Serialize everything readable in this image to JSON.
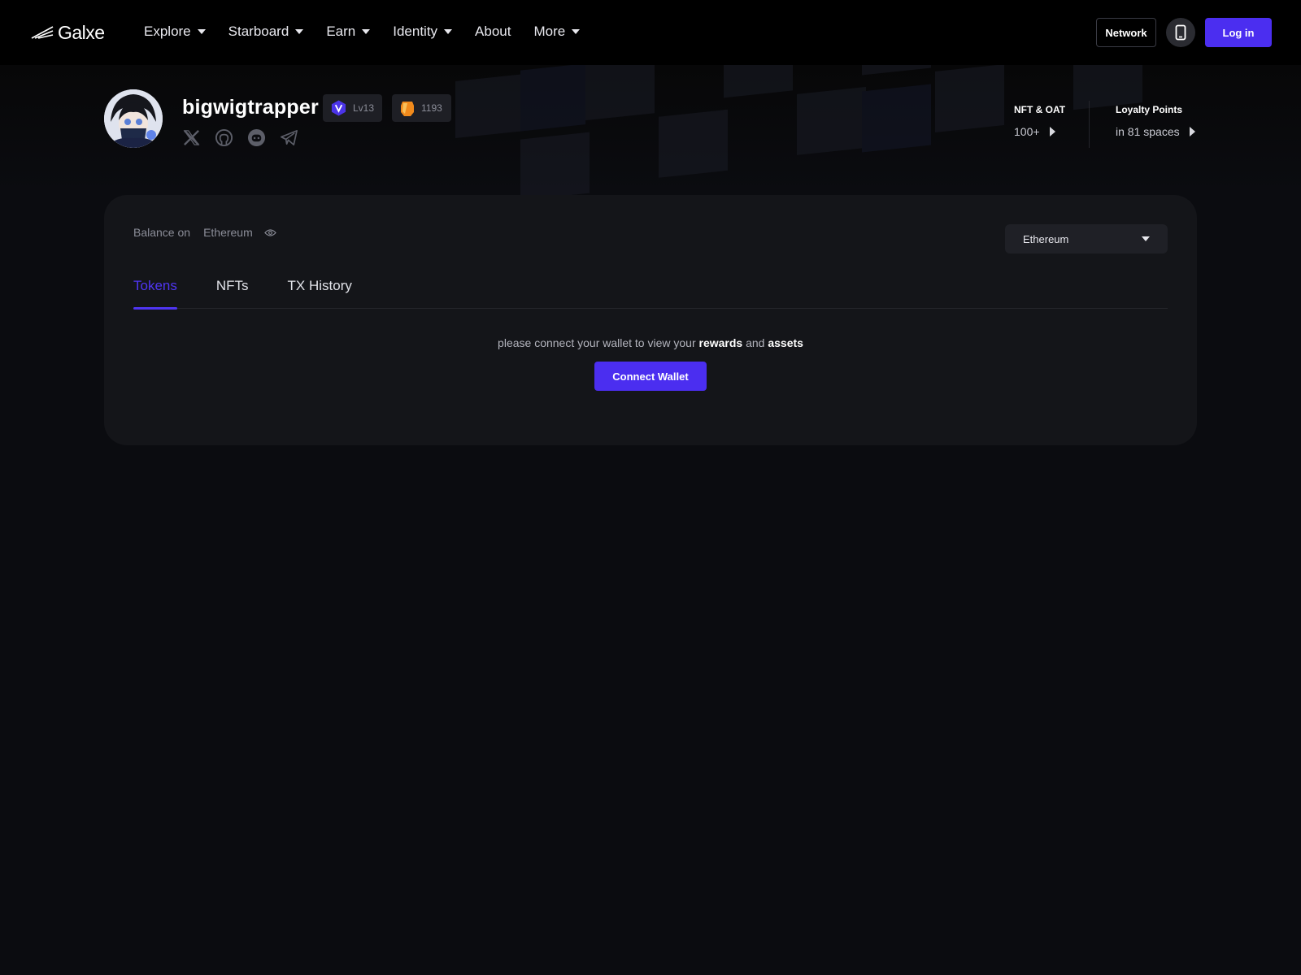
{
  "header": {
    "logo_text": "Galxe",
    "nav": [
      {
        "label": "Explore",
        "has_dropdown": true
      },
      {
        "label": "Starboard",
        "has_dropdown": true
      },
      {
        "label": "Earn",
        "has_dropdown": true
      },
      {
        "label": "Identity",
        "has_dropdown": true
      },
      {
        "label": "About",
        "has_dropdown": false
      },
      {
        "label": "More",
        "has_dropdown": true
      }
    ],
    "network_button": "Network",
    "phone_icon": "mobile-phone-icon",
    "login_button": "Log in"
  },
  "profile": {
    "username": "bigwigtrapper",
    "level_badge": {
      "icon": "v-shield-icon",
      "text": "Lv13"
    },
    "points_badge": {
      "icon": "orange-gem-icon",
      "text": "1193"
    },
    "socials": [
      "x-twitter-icon",
      "github-icon",
      "discord-icon",
      "telegram-icon"
    ],
    "stats": [
      {
        "label": "NFT & OAT",
        "value": "100+"
      },
      {
        "label": "Loyalty Points",
        "value": "in 81 spaces"
      }
    ]
  },
  "balance": {
    "label": "Balance on",
    "chain": "Ethereum",
    "eye_icon": "eye-icon",
    "selector_value": "Ethereum"
  },
  "tabs": [
    {
      "label": "Tokens",
      "active": true
    },
    {
      "label": "NFTs",
      "active": false
    },
    {
      "label": "TX History",
      "active": false
    }
  ],
  "empty_state": {
    "prefix": "please connect your wallet to view your ",
    "rewards": "rewards",
    "and": " and ",
    "assets": "assets",
    "button": "Connect Wallet"
  },
  "colors": {
    "accent": "#4b2ef0",
    "tab_active": "#4f35f2",
    "background": "#0b0c10",
    "card": "#141519"
  }
}
